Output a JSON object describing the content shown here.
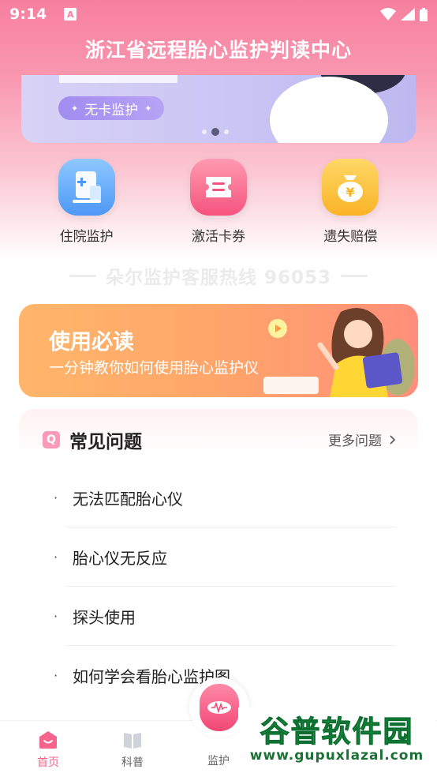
{
  "status_bar": {
    "time": "9:14",
    "notification_badge": "A"
  },
  "header": {
    "title": "浙江省远程胎心监护判读中心"
  },
  "banner": {
    "pill_label": "无卡监护",
    "slide_count": 3,
    "active_slide": 2
  },
  "quick_actions": [
    {
      "label": "住院监护",
      "icon": "hospital-card-icon",
      "color": "#4d98f5"
    },
    {
      "label": "激活卡券",
      "icon": "ticket-icon",
      "color": "#f5537e"
    },
    {
      "label": "遗失赔偿",
      "icon": "money-bag-icon",
      "color": "#f9b326"
    }
  ],
  "hotline": {
    "text": "朵尔监护客服热线 96053"
  },
  "guide_card": {
    "title": "使用必读",
    "subtitle": "一分钟教你如何使用胎心监护仪"
  },
  "faq": {
    "title": "常见问题",
    "more_label": "更多问题",
    "items": [
      {
        "bullet": "·",
        "text": "无法匹配胎心仪"
      },
      {
        "bullet": "·",
        "text": "胎心仪无反应"
      },
      {
        "bullet": "·",
        "text": "探头使用"
      },
      {
        "bullet": "·",
        "text": "如何学会看胎心监护图"
      }
    ]
  },
  "tabbar": {
    "tabs": [
      {
        "label": "首页",
        "icon": "home-icon",
        "active": true
      },
      {
        "label": "科普",
        "icon": "book-icon",
        "active": false
      },
      {
        "label": "监护",
        "icon": "monitor-device-icon",
        "active": false
      }
    ]
  },
  "watermark": {
    "brand": "谷普软件园",
    "url": "www.gupuxlazal.com"
  },
  "colors": {
    "accent": "#f6648b",
    "header_gradient_top": "#f77fa0",
    "guide_orange": "#ffa56a"
  }
}
